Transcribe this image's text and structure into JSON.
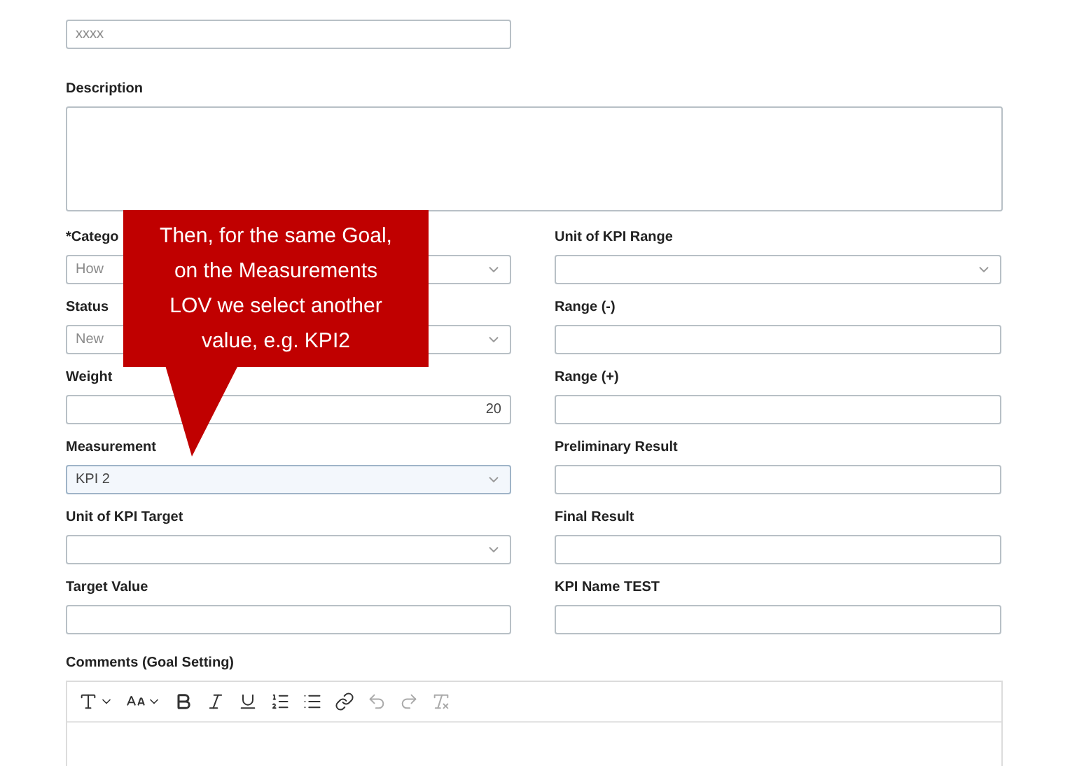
{
  "top_field": {
    "value": "xxxx",
    "disabled": true
  },
  "description": {
    "label": "Description",
    "kind": "textarea"
  },
  "columns": [
    [
      {
        "label": "*Catego",
        "kind": "select",
        "value": "How",
        "disabled": true,
        "highlighted": false
      },
      {
        "label": "Status",
        "kind": "select",
        "value": "New",
        "disabled": true,
        "highlighted": false
      },
      {
        "label": "Weight",
        "kind": "number",
        "value": "20",
        "disabled": false,
        "highlighted": false
      },
      {
        "label": "Measurement",
        "kind": "select",
        "value": "KPI 2",
        "disabled": false,
        "highlighted": true
      },
      {
        "label": "Unit of KPI Target",
        "kind": "select",
        "highlighted": false
      },
      {
        "label": "Target Value",
        "kind": "text",
        "highlighted": false
      }
    ],
    [
      {
        "label": "Unit of KPI Range",
        "kind": "select",
        "highlighted": false
      },
      {
        "label": "Range (-)",
        "kind": "text",
        "highlighted": false
      },
      {
        "label": "Range (+)",
        "kind": "text",
        "highlighted": false
      },
      {
        "label": "Preliminary Result",
        "kind": "text",
        "highlighted": false
      },
      {
        "label": "Final Result",
        "kind": "text",
        "highlighted": false
      },
      {
        "label": "KPI Name TEST",
        "kind": "text",
        "highlighted": false
      }
    ]
  ],
  "comments": {
    "label": "Comments (Goal Setting)",
    "toolbar": [
      {
        "kind": "font",
        "disabled": false
      },
      {
        "kind": "size",
        "disabled": false
      },
      {
        "kind": "bold",
        "disabled": false
      },
      {
        "kind": "italic",
        "disabled": false
      },
      {
        "kind": "underline",
        "disabled": false
      },
      {
        "kind": "ordered-list",
        "disabled": false
      },
      {
        "kind": "bullet-list",
        "disabled": false
      },
      {
        "kind": "link",
        "disabled": false
      },
      {
        "kind": "undo",
        "disabled": true
      },
      {
        "kind": "redo",
        "disabled": true
      },
      {
        "kind": "clear-format",
        "disabled": true
      }
    ]
  },
  "callout": {
    "text": "Then, for the same Goal, on the Measurements LOV we select another value, e.g. KPI2"
  }
}
